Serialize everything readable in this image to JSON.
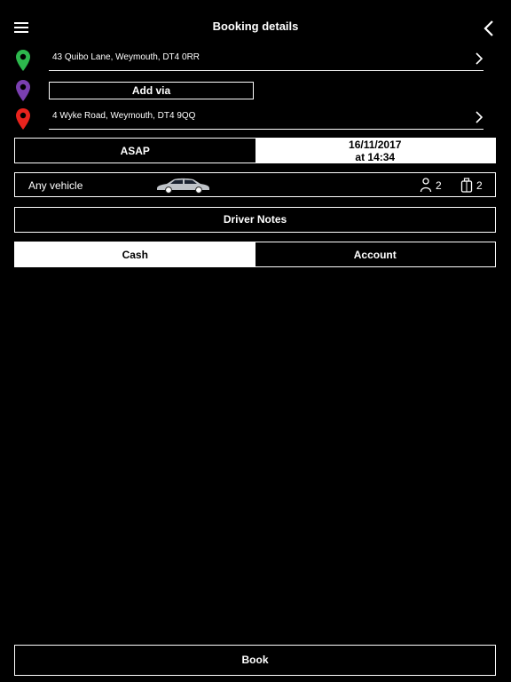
{
  "header": {
    "title": "Booking details",
    "menu_icon": "hamburger-menu-icon",
    "back_icon": "chevron-left-icon"
  },
  "route": {
    "pickup": {
      "address": "43 Quibo Lane, Weymouth, DT4 0RR",
      "pin_color": "#2db84d",
      "icon": "map-pin-icon"
    },
    "via": {
      "label": "Add via",
      "pin_color": "#7a3fb0",
      "icon": "map-pin-icon"
    },
    "dropoff": {
      "address": "4 Wyke Road, Weymouth, DT4 9QQ",
      "pin_color": "#e8231d",
      "icon": "map-pin-icon"
    }
  },
  "timing": {
    "asap_label": "ASAP",
    "date": "16/11/2017",
    "time": "at 14:34",
    "selected": "datetime"
  },
  "vehicle": {
    "label": "Any vehicle",
    "icon": "car-icon",
    "passengers": "2",
    "passenger_icon": "person-icon",
    "luggage": "2",
    "luggage_icon": "luggage-icon"
  },
  "driver_notes_label": "Driver Notes",
  "payment": {
    "cash_label": "Cash",
    "account_label": "Account",
    "selected": "cash"
  },
  "book_label": "Book"
}
